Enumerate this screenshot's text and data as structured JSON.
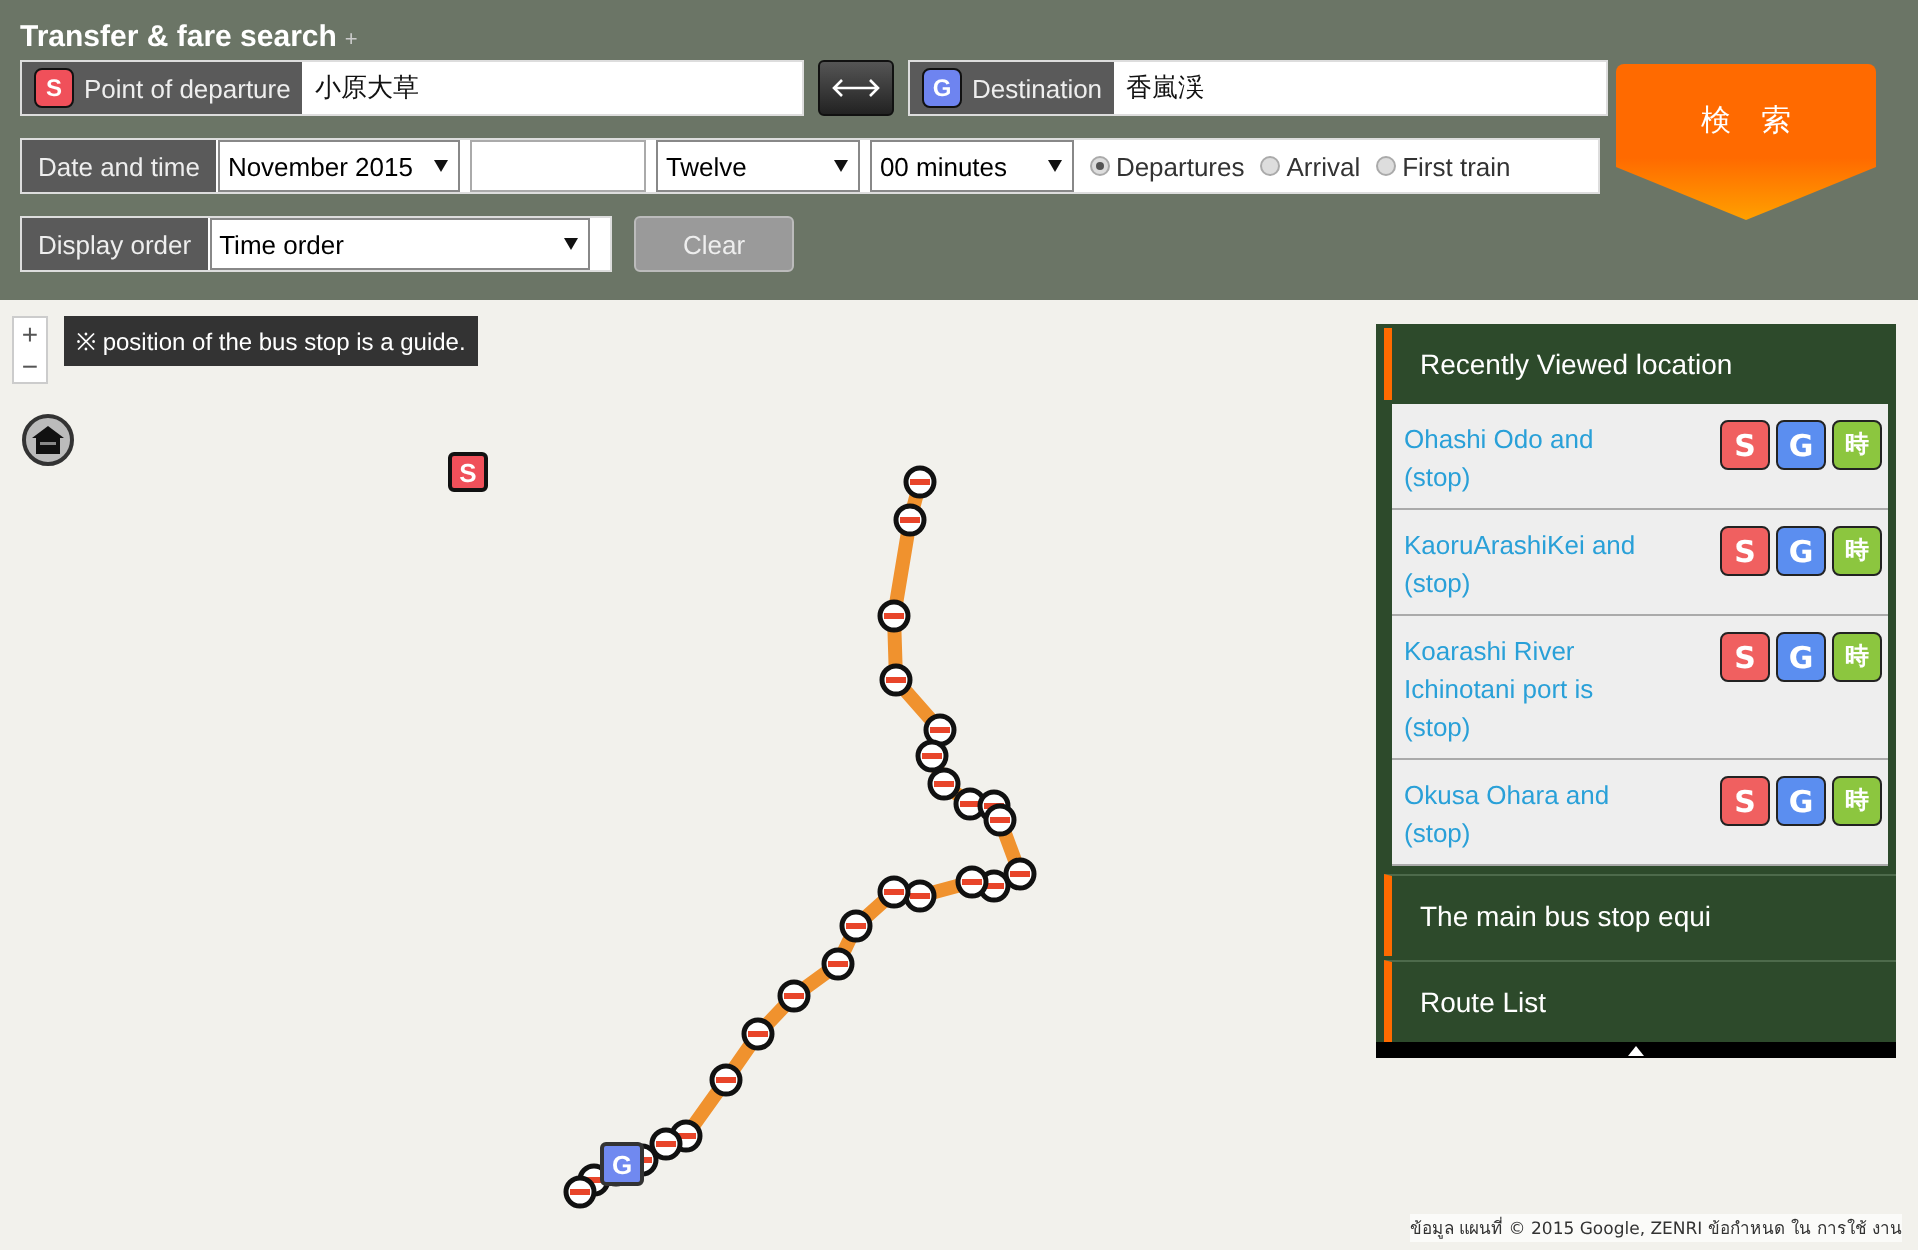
{
  "header": {
    "title": "Transfer & fare search",
    "expand_mark": "+"
  },
  "departure": {
    "badge": "S",
    "label": "Point of departure",
    "value": "小原大草"
  },
  "destination": {
    "badge": "G",
    "label": "Destination",
    "value": "香嵐渓"
  },
  "search_button": "検　索",
  "date_time": {
    "label": "Date and time",
    "month": "November 2015",
    "hour": "Twelve",
    "minute": "00 minutes",
    "radios": [
      {
        "label": "Departures",
        "selected": true
      },
      {
        "label": "Arrival",
        "selected": false
      },
      {
        "label": "First train",
        "selected": false
      }
    ]
  },
  "display_order": {
    "label": "Display order",
    "value": "Time order"
  },
  "clear_button": "Clear",
  "map": {
    "notice": "※ position of the bus stop is a guide.",
    "zoom_in": "+",
    "zoom_out": "−",
    "start_marker": "S",
    "goal_marker": "G",
    "attribution": "ข้อมูล แผนที่ © 2015 Google, ZENRI ข้อกำหนด ใน การใช้ งาน"
  },
  "panel": {
    "sections": [
      {
        "title": "Recently Viewed location",
        "expanded": true,
        "items": [
          {
            "name": "Ohashi Odo and (stop)",
            "buttons": [
              "S",
              "G",
              "時"
            ]
          },
          {
            "name": "KaoruArashiKei and (stop)",
            "buttons": [
              "S",
              "G",
              "時"
            ]
          },
          {
            "name": "Koarashi River Ichinotani port is (stop)",
            "buttons": [
              "S",
              "G",
              "時"
            ]
          },
          {
            "name": "Okusa Ohara and (stop)",
            "buttons": [
              "S",
              "G",
              "時"
            ]
          }
        ]
      },
      {
        "title": "The main bus stop equi",
        "expanded": false
      },
      {
        "title": "Route List",
        "expanded": false
      }
    ]
  }
}
